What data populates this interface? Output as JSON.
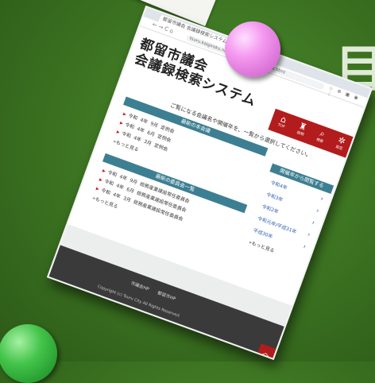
{
  "background_text": "目",
  "browser": {
    "tab_title": "都留市議会 会議録検索システム",
    "nav": "← → C ⌂",
    "url": "tsuru.kaigiroku.net/tenant/tsuru/pg/index.html",
    "icons": "☆ ⊕ ▣ ◉ ⋮"
  },
  "site": {
    "title_line1": "都留市議会",
    "title_line2": "会議録検索システム",
    "nav": [
      {
        "icon": "⌂",
        "label": "TOP"
      },
      {
        "icon": "♜",
        "label": "説明"
      },
      {
        "icon": "⌕",
        "label": "検索"
      },
      {
        "icon": "✲",
        "label": "設定"
      }
    ],
    "intro": "ご覧になる会議名や開催年を、一覧から選択してください。"
  },
  "latest_plenary": {
    "heading": "最新の本会議",
    "rows": [
      {
        "era": "令和",
        "year": "4年",
        "month": "9月",
        "name": "定例会"
      },
      {
        "era": "令和",
        "year": "4年",
        "month": "6月",
        "name": "定例会"
      },
      {
        "era": "令和",
        "year": "4年",
        "month": "3月",
        "name": "定例会"
      }
    ],
    "more": "»もっと見る"
  },
  "latest_committee": {
    "heading": "最新の委員会一覧",
    "rows": [
      {
        "era": "令和",
        "year": "4年",
        "month": "9月",
        "name": "総務産業建設常任委員会"
      },
      {
        "era": "令和",
        "year": "4年",
        "month": "6月",
        "name": "総務産業建設常任委員会"
      },
      {
        "era": "令和",
        "year": "4年",
        "month": "3月",
        "name": "総務産業建設常任委員会"
      }
    ],
    "more": "»もっと見る"
  },
  "by_year": {
    "heading": "開催年から閲覧する",
    "years": [
      "令和4年",
      "令和3年",
      "令和2年",
      "令和元年/平成31年",
      "平成30年"
    ],
    "more": "»もっと見る"
  },
  "footer": {
    "links": "市議会HP 都留市HP",
    "copyright": "Copyright (c) Tsuru City All Rights Reserved.",
    "totop": "︿"
  },
  "colors": {
    "accent_red": "#b31c1c",
    "section_teal": "#3d7f92",
    "board_green": "#3a7020"
  }
}
